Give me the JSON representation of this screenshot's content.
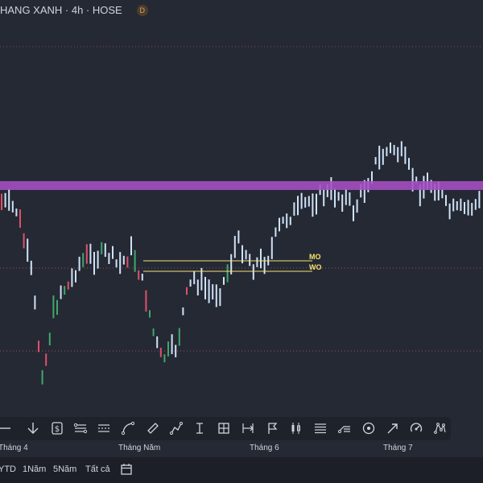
{
  "header": {
    "title": "HANG XANH · 4h · HOSE",
    "badge": "D"
  },
  "levels": [
    {
      "label": "MO",
      "color": "#f5e36b"
    },
    {
      "label": "WO",
      "color": "#f5e36b"
    }
  ],
  "colors": {
    "background": "#252934",
    "up_bar": "#3fa86a",
    "down_bar": "#e0506a",
    "neutral_bar": "#cfe3f7",
    "resistance_band": "#a64fc4",
    "level_line": "#f5e36b",
    "dotted_line": "#9c4a6a"
  },
  "toolbar": {
    "icons": [
      "line-tool-icon",
      "arrow-down-icon",
      "price-label-icon",
      "parallel-channel-icon",
      "regression-channel-icon",
      "curve-icon",
      "rectangle-icon",
      "path-icon",
      "text-cursor-icon",
      "grid-icon",
      "range-icon",
      "flag-icon",
      "candlestick-icon",
      "fibonacci-icon",
      "pitchfork-icon",
      "circle-target-icon",
      "arrow-up-right-icon",
      "gauge-icon",
      "pattern-icon"
    ]
  },
  "time_axis": {
    "ticks": [
      "Tháng 4",
      "Tháng Năm",
      "Tháng 6",
      "Tháng 7"
    ]
  },
  "periods": {
    "items": [
      "YTD",
      "1Năm",
      "5Năm",
      "Tất cả"
    ],
    "calendar_icon": "calendar-icon"
  }
}
